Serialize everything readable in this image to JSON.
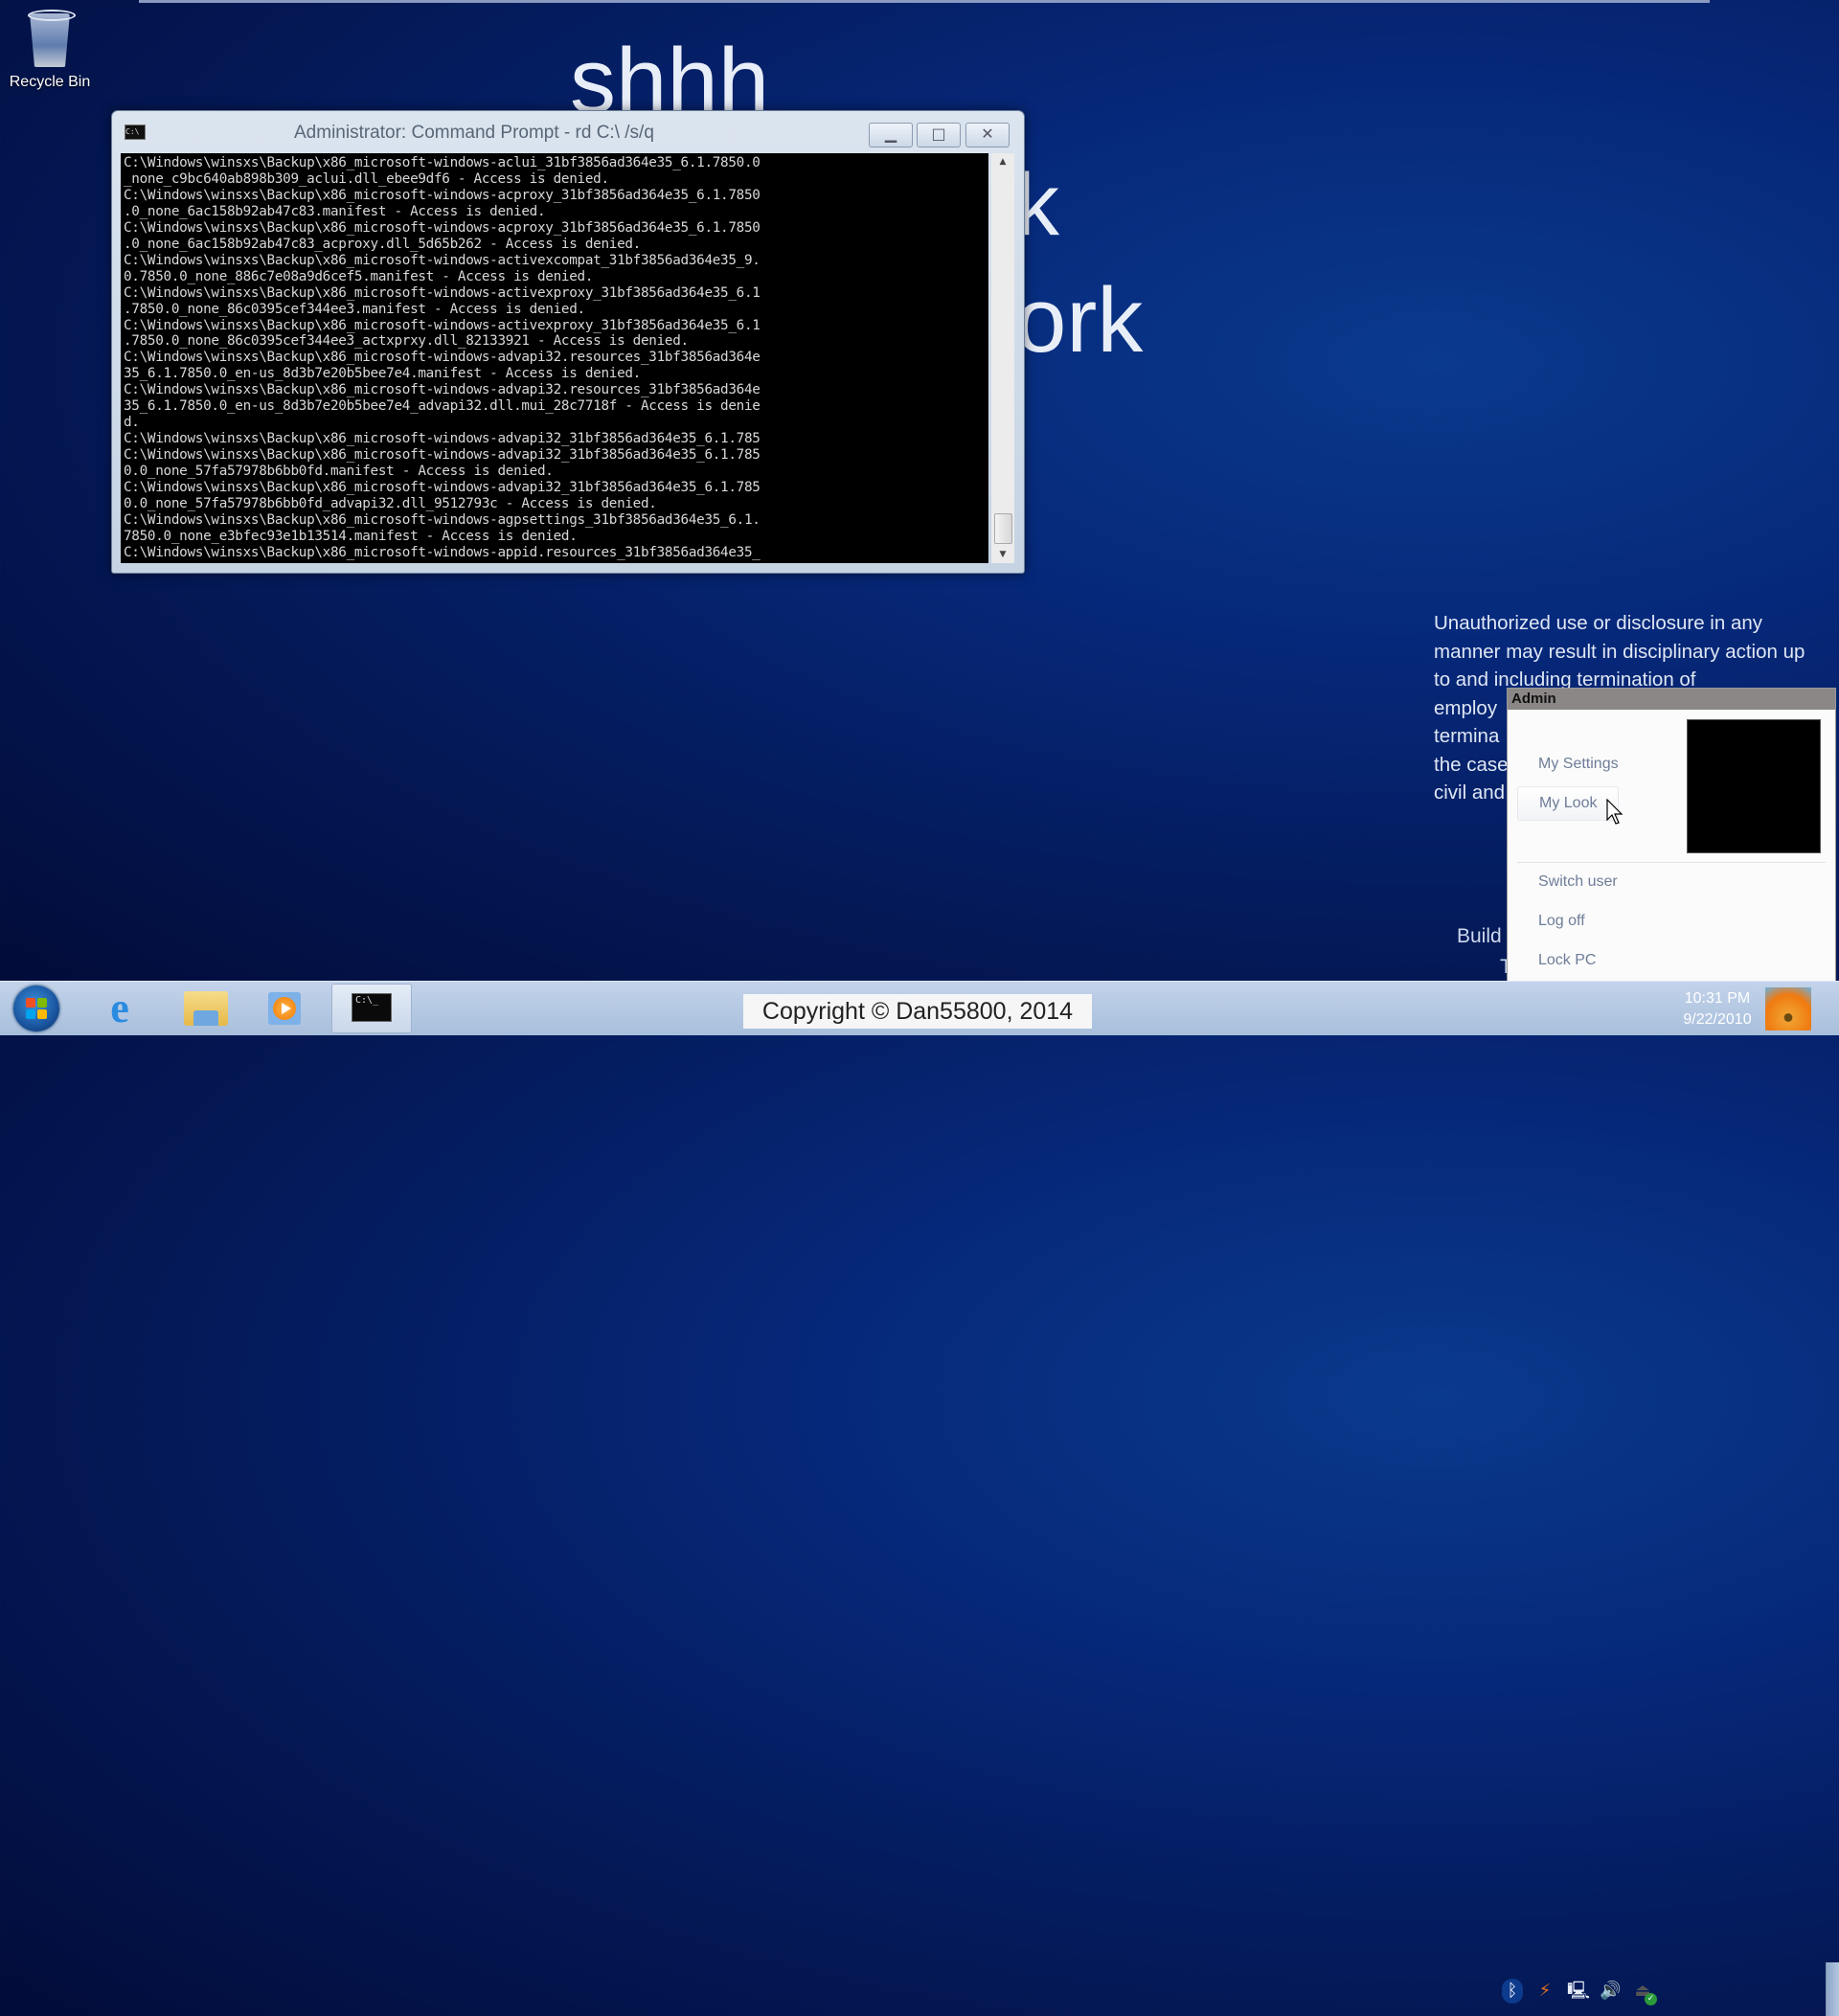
{
  "desktop": {
    "icons": [
      {
        "label": "Recycle Bin",
        "icon": "recycle-bin-icon"
      }
    ],
    "background_words": [
      "shhh",
      "k",
      "ork"
    ]
  },
  "cmd_window": {
    "title": "Administrator: Command Prompt - rd  C:\\ /s/q",
    "icon_text": "C:\\",
    "buttons": {
      "minimize": "▁",
      "maximize": "□",
      "close": "✕"
    },
    "lines": [
      "C:\\Windows\\winsxs\\Backup\\x86_microsoft-windows-aclui_31bf3856ad364e35_6.1.7850.0",
      "_none_c9bc640ab898b309_aclui.dll_ebee9df6 - Access is denied.",
      "C:\\Windows\\winsxs\\Backup\\x86_microsoft-windows-acproxy_31bf3856ad364e35_6.1.7850",
      ".0_none_6ac158b92ab47c83.manifest - Access is denied.",
      "C:\\Windows\\winsxs\\Backup\\x86_microsoft-windows-acproxy_31bf3856ad364e35_6.1.7850",
      ".0_none_6ac158b92ab47c83_acproxy.dll_5d65b262 - Access is denied.",
      "C:\\Windows\\winsxs\\Backup\\x86_microsoft-windows-activexcompat_31bf3856ad364e35_9.",
      "0.7850.0_none_886c7e08a9d6cef5.manifest - Access is denied.",
      "C:\\Windows\\winsxs\\Backup\\x86_microsoft-windows-activexproxy_31bf3856ad364e35_6.1",
      ".7850.0_none_86c0395cef344ee3.manifest - Access is denied.",
      "C:\\Windows\\winsxs\\Backup\\x86_microsoft-windows-activexproxy_31bf3856ad364e35_6.1",
      ".7850.0_none_86c0395cef344ee3_actxprxy.dll_82133921 - Access is denied.",
      "C:\\Windows\\winsxs\\Backup\\x86_microsoft-windows-advapi32.resources_31bf3856ad364e",
      "35_6.1.7850.0_en-us_8d3b7e20b5bee7e4.manifest - Access is denied.",
      "C:\\Windows\\winsxs\\Backup\\x86_microsoft-windows-advapi32.resources_31bf3856ad364e",
      "35_6.1.7850.0_en-us_8d3b7e20b5bee7e4_advapi32.dll.mui_28c7718f - Access is denie",
      "d.",
      "C:\\Windows\\winsxs\\Backup\\x86_microsoft-windows-advapi32_31bf3856ad364e35_6.1.785",
      "C:\\Windows\\winsxs\\Backup\\x86_microsoft-windows-advapi32_31bf3856ad364e35_6.1.785",
      "0.0_none_57fa57978b6bb0fd.manifest - Access is denied.",
      "C:\\Windows\\winsxs\\Backup\\x86_microsoft-windows-advapi32_31bf3856ad364e35_6.1.785",
      "0.0_none_57fa57978b6bb0fd_advapi32.dll_9512793c - Access is denied.",
      "C:\\Windows\\winsxs\\Backup\\x86_microsoft-windows-agpsettings_31bf3856ad364e35_6.1.",
      "7850.0_none_e3bfec93e1b13514.manifest - Access is denied.",
      "C:\\Windows\\winsxs\\Backup\\x86_microsoft-windows-appid.resources_31bf3856ad364e35_"
    ],
    "scrollbar": {
      "up": "▲",
      "down": "▼",
      "position": 0.93
    }
  },
  "legal_notice": {
    "lines": [
      "Unauthorized use or disclosure in any",
      "manner may result in disciplinary action up",
      "to and including termination of",
      "employ",
      "termina",
      "the case",
      "civil and"
    ],
    "build_text": "Build",
    "build_text2": "T"
  },
  "admin_menu": {
    "title": "Admin",
    "items": [
      {
        "label": "My Settings"
      },
      {
        "label": "My Look",
        "hovered": true
      },
      {
        "label": "Switch user"
      },
      {
        "label": "Log off"
      },
      {
        "label": "Lock PC"
      }
    ]
  },
  "taskbar": {
    "pinned": [
      {
        "name": "start",
        "icon": "windows-logo-icon"
      },
      {
        "name": "internet-explorer",
        "icon": "internet-explorer-icon",
        "glyph": "e"
      },
      {
        "name": "windows-explorer",
        "icon": "folder-icon"
      },
      {
        "name": "media-player",
        "icon": "media-player-icon"
      },
      {
        "name": "command-prompt",
        "icon": "cmd-icon",
        "glyph": "C:\\_",
        "active": true
      }
    ],
    "copyright": "Copyright © Dan55800, 2014",
    "tray": {
      "icons": [
        "bluetooth-icon",
        "network-warning-icon",
        "network-icon",
        "volume-icon",
        "usb-safe-remove-icon"
      ],
      "glyphs": [
        "ᛒ",
        "⚡",
        "🖳",
        "🔊",
        "⏏"
      ],
      "time": "10:31 PM",
      "date": "9/22/2010"
    },
    "flag_colors": [
      "#f25022",
      "#7fba00",
      "#00a4ef",
      "#ffb900"
    ]
  }
}
